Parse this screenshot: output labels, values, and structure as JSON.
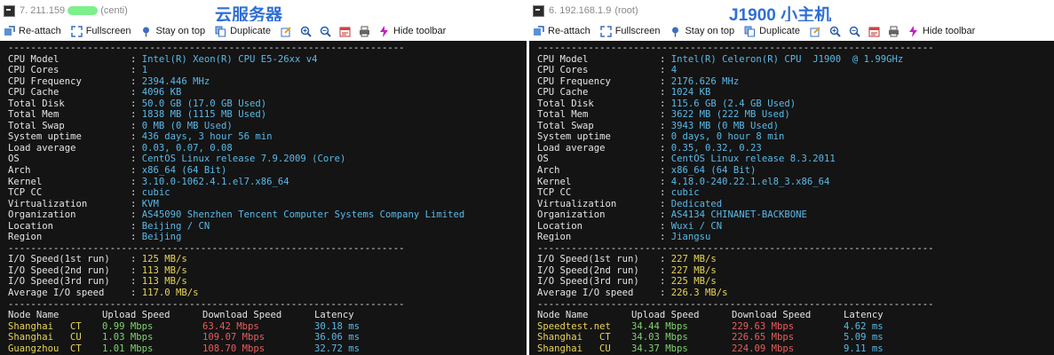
{
  "left": {
    "tab_title": "7. 211.159",
    "tab_user": "(centi)",
    "overlay_label": "云服务器",
    "toolbar": [
      "Re-attach",
      "Fullscreen",
      "Stay on top",
      "Duplicate",
      "Hide toolbar"
    ],
    "separator": "----------------------------------------------------------------------",
    "sysinfo": [
      {
        "key": "CPU Model",
        "value": "Intel(R) Xeon(R) CPU E5-26xx v4"
      },
      {
        "key": "CPU Cores",
        "value": "1"
      },
      {
        "key": "CPU Frequency",
        "value": "2394.446 MHz"
      },
      {
        "key": "CPU Cache",
        "value": "4096 KB"
      },
      {
        "key": "Total Disk",
        "value": "50.0 GB (17.0 GB Used)"
      },
      {
        "key": "Total Mem",
        "value": "1838 MB (1115 MB Used)"
      },
      {
        "key": "Total Swap",
        "value": "0 MB (0 MB Used)"
      },
      {
        "key": "System uptime",
        "value": "436 days, 3 hour 56 min"
      },
      {
        "key": "Load average",
        "value": "0.03, 0.07, 0.08"
      },
      {
        "key": "OS",
        "value": "CentOS Linux release 7.9.2009 (Core)"
      },
      {
        "key": "Arch",
        "value": "x86_64 (64 Bit)"
      },
      {
        "key": "Kernel",
        "value": "3.10.0-1062.4.1.el7.x86_64"
      },
      {
        "key": "TCP CC",
        "value": "cubic"
      },
      {
        "key": "Virtualization",
        "value": "KVM"
      },
      {
        "key": "Organization",
        "value": "AS45090 Shenzhen Tencent Computer Systems Company Limited"
      },
      {
        "key": "Location",
        "value": "Beijing / CN"
      },
      {
        "key": "Region",
        "value": "Beijing"
      }
    ],
    "io": [
      {
        "key": "I/O Speed(1st run)",
        "value": "125 MB/s"
      },
      {
        "key": "I/O Speed(2nd run)",
        "value": "113 MB/s"
      },
      {
        "key": "I/O Speed(3rd run)",
        "value": "113 MB/s"
      },
      {
        "key": "Average I/O speed",
        "value": "117.0 MB/s"
      }
    ],
    "speed_header": [
      "Node Name",
      "Upload Speed",
      "Download Speed",
      "Latency"
    ],
    "speed_rows": [
      {
        "city": "Shanghai",
        "isp": "CT",
        "up": "0.99 Mbps",
        "down": "63.42 Mbps",
        "lat": "30.18 ms"
      },
      {
        "city": "Shanghai",
        "isp": "CU",
        "up": "1.03 Mbps",
        "down": "109.07 Mbps",
        "lat": "36.06 ms"
      },
      {
        "city": "Guangzhou",
        "isp": "CT",
        "up": "1.01 Mbps",
        "down": "108.70 Mbps",
        "lat": "32.72 ms"
      }
    ]
  },
  "right": {
    "tab_title": "6. 192.168.1.9",
    "tab_user": "(root)",
    "overlay_label": "J1900 小主机",
    "toolbar": [
      "Re-attach",
      "Fullscreen",
      "Stay on top",
      "Duplicate",
      "Hide toolbar"
    ],
    "separator": "----------------------------------------------------------------------",
    "sysinfo": [
      {
        "key": "CPU Model",
        "value": "Intel(R) Celeron(R) CPU  J1900  @ 1.99GHz"
      },
      {
        "key": "CPU Cores",
        "value": "4"
      },
      {
        "key": "CPU Frequency",
        "value": "2176.626 MHz"
      },
      {
        "key": "CPU Cache",
        "value": "1024 KB"
      },
      {
        "key": "Total Disk",
        "value": "115.6 GB (2.4 GB Used)"
      },
      {
        "key": "Total Mem",
        "value": "3622 MB (222 MB Used)"
      },
      {
        "key": "Total Swap",
        "value": "3943 MB (0 MB Used)"
      },
      {
        "key": "System uptime",
        "value": "0 days, 0 hour 8 min"
      },
      {
        "key": "Load average",
        "value": "0.35, 0.32, 0.23"
      },
      {
        "key": "OS",
        "value": "CentOS Linux release 8.3.2011"
      },
      {
        "key": "Arch",
        "value": "x86_64 (64 Bit)"
      },
      {
        "key": "Kernel",
        "value": "4.18.0-240.22.1.el8_3.x86_64"
      },
      {
        "key": "TCP CC",
        "value": "cubic"
      },
      {
        "key": "Virtualization",
        "value": "Dedicated"
      },
      {
        "key": "Organization",
        "value": "AS4134 CHINANET-BACKBONE"
      },
      {
        "key": "Location",
        "value": "Wuxi / CN"
      },
      {
        "key": "Region",
        "value": "Jiangsu"
      }
    ],
    "io": [
      {
        "key": "I/O Speed(1st run)",
        "value": "227 MB/s"
      },
      {
        "key": "I/O Speed(2nd run)",
        "value": "227 MB/s"
      },
      {
        "key": "I/O Speed(3rd run)",
        "value": "225 MB/s"
      },
      {
        "key": "Average I/O speed",
        "value": "226.3 MB/s"
      }
    ],
    "speed_header": [
      "Node Name",
      "Upload Speed",
      "Download Speed",
      "Latency"
    ],
    "speed_rows": [
      {
        "city": "Speedtest.net",
        "isp": "",
        "up": "34.44 Mbps",
        "down": "229.63 Mbps",
        "lat": "4.62 ms"
      },
      {
        "city": "Shanghai",
        "isp": "CT",
        "up": "34.03 Mbps",
        "down": "226.65 Mbps",
        "lat": "5.09 ms"
      },
      {
        "city": "Shanghai",
        "isp": "CU",
        "up": "34.37 Mbps",
        "down": "224.09 Mbps",
        "lat": "9.11 ms"
      }
    ]
  },
  "colors": {
    "terminal_bg": "#141414",
    "value_cyan": "#5ab9e8",
    "value_yellow": "#e8d45a",
    "value_green": "#7fd36f",
    "value_red": "#e85d5d",
    "overlay_blue": "#2f6fd6"
  },
  "icons": [
    "terminal-tab-icon",
    "reattach-icon",
    "fullscreen-icon",
    "pin-icon",
    "duplicate-icon",
    "edit-icon",
    "zoom-in-icon",
    "zoom-out-icon",
    "macro-icon",
    "print-icon",
    "bolt-icon"
  ]
}
